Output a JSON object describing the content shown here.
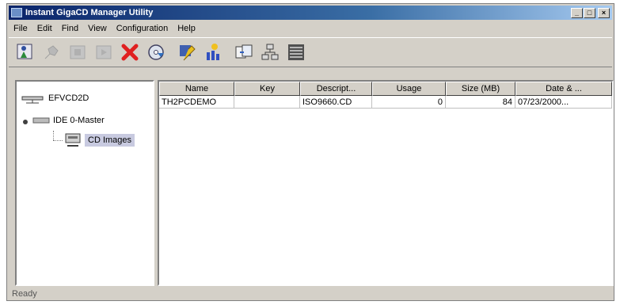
{
  "window": {
    "title": "Instant GigaCD Manager Utility"
  },
  "title_buttons": {
    "minimize": "_",
    "maximize": "□",
    "close": "×"
  },
  "menu": [
    "File",
    "Edit",
    "Find",
    "View",
    "Configuration",
    "Help"
  ],
  "toolbar": {
    "icons": [
      "wizard-icon",
      "tool-disabled-icon",
      "tool-disabled-icon",
      "tool-disabled-icon",
      "delete-icon",
      "eject-disc-icon",
      "properties-icon",
      "statistics-icon",
      "copy-icon",
      "network-icon",
      "list-view-icon"
    ]
  },
  "tree": {
    "server": "EFVCD2D",
    "drive": "IDE 0-Master",
    "folder": "CD Images"
  },
  "list": {
    "columns": [
      "Name",
      "Key",
      "Descript...",
      "Usage",
      "Size (MB)",
      "Date & ..."
    ],
    "rows": [
      {
        "name": "TH2PCDEMO",
        "key": "",
        "description": "ISO9660.CD",
        "usage": "0",
        "size": "84",
        "date": "07/23/2000..."
      }
    ]
  },
  "status": "Ready",
  "colors": {
    "title_start": "#0a246a",
    "title_end": "#a6caf0",
    "selection": "#c8cae0",
    "delete_red": "#e02020"
  }
}
